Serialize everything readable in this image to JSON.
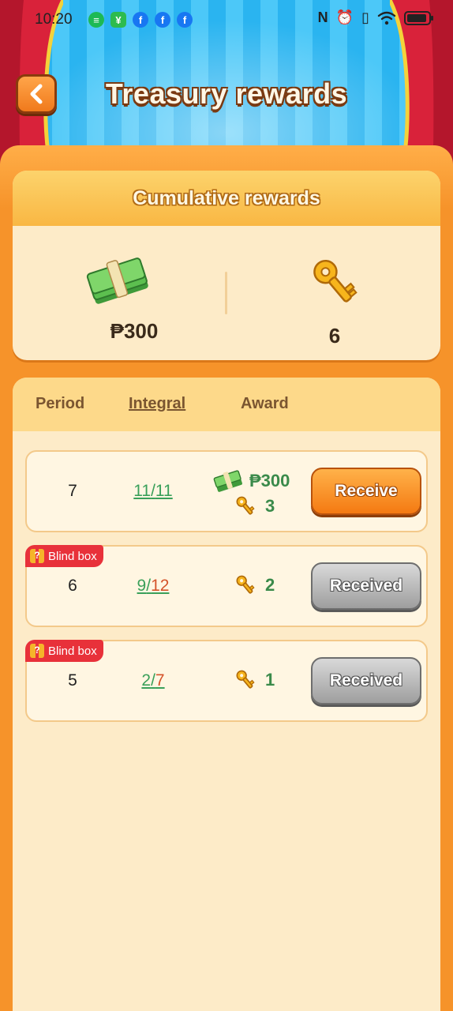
{
  "status_bar": {
    "time": "10:20",
    "app_icons": [
      "spotify-icon",
      "wechat-icon",
      "facebook-icon",
      "facebook-icon",
      "facebook-icon"
    ],
    "right_icons": [
      "nfc-icon",
      "alarm-icon",
      "vibrate-icon",
      "wifi-icon",
      "battery-icon"
    ]
  },
  "header": {
    "title": "Treasury rewards"
  },
  "cumulative": {
    "title": "Cumulative rewards",
    "money": "₱300",
    "keys": "6"
  },
  "table": {
    "headers": {
      "period": "Period",
      "integral": "Integral",
      "award": "Award"
    },
    "rows": [
      {
        "period": "7",
        "integral_done": "11",
        "integral_total": "11",
        "blind_box": "",
        "money": "₱300",
        "keys": "3",
        "button": "Receive"
      },
      {
        "period": "6",
        "integral_done": "9",
        "integral_total": "12",
        "blind_box": "Blind box",
        "money": "",
        "keys": "2",
        "button": "Received"
      },
      {
        "period": "5",
        "integral_done": "2",
        "integral_total": "7",
        "blind_box": "Blind box",
        "money": "",
        "keys": "1",
        "button": "Received"
      }
    ]
  },
  "colors": {
    "panel_orange": "#f6932a",
    "cream": "#fdebc8",
    "receive_button": "#f47a12",
    "received_button": "#9e9e9e",
    "award_green": "#3a8a4a",
    "blind_box_red": "#e8313a"
  }
}
